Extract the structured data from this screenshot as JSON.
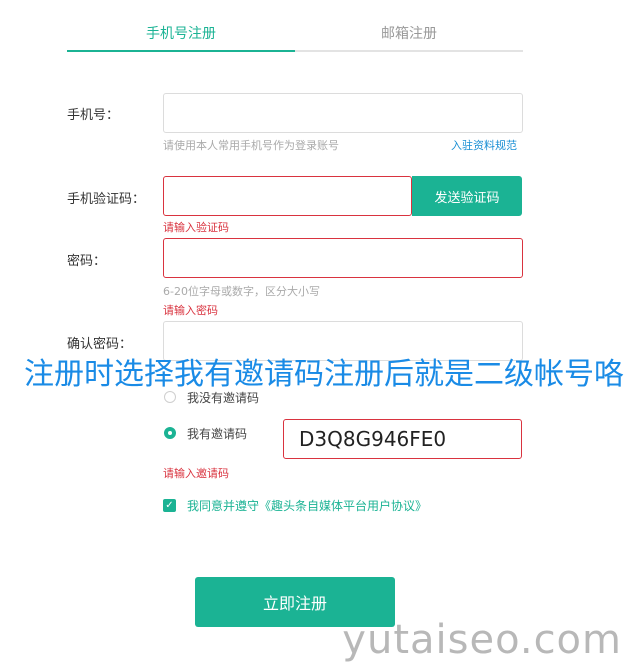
{
  "tabs": [
    {
      "label": "手机号注册"
    },
    {
      "label": "邮箱注册"
    }
  ],
  "phone": {
    "label": "手机号：",
    "value": "",
    "hint": "请使用本人常用手机号作为登录账号",
    "rules_link": "入驻资料规范"
  },
  "code": {
    "label": "手机验证码：",
    "value": "",
    "send_button": "发送验证码",
    "error": "请输入验证码"
  },
  "password": {
    "label": "密码：",
    "value": "",
    "hint": "6-20位字母或数字，区分大小写",
    "error": "请输入密码"
  },
  "confirm": {
    "label": "确认密码：",
    "value": ""
  },
  "invite": {
    "option_none": "我没有邀请码",
    "option_have": "我有邀请码",
    "value": "D3Q8G946FE0",
    "error": "请输入邀请码"
  },
  "agreement": {
    "text": "我同意并遵守《趣头条自媒体平台用户协议》"
  },
  "submit": {
    "label": "立即注册"
  },
  "overlay_text": "注册时选择我有邀请码注册后就是二级帐号咯",
  "watermark": "yutaiseo.com",
  "colors": {
    "accent": "#1bb394",
    "error": "#d9333f",
    "link": "#1a8fd4",
    "overlay": "#1a8be6"
  }
}
